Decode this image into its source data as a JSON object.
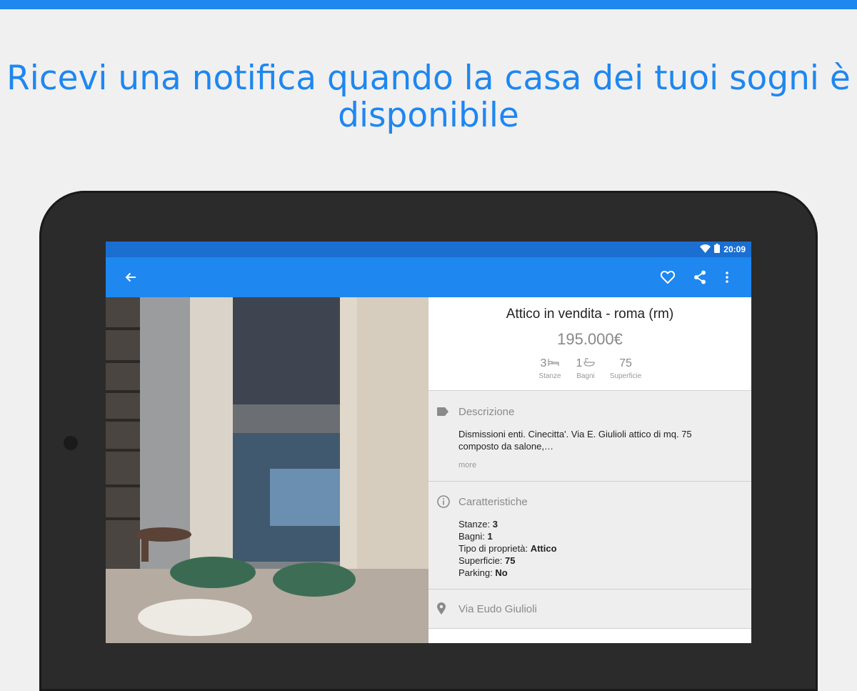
{
  "headline": "Ricevi una notifica quando la casa dei tuoi sogni è disponibile",
  "statusbar": {
    "time": "20:09"
  },
  "listing": {
    "title": "Attico in vendita - roma (rm)",
    "price": "195.000€",
    "stats": [
      {
        "value": "3",
        "label": "Stanze",
        "icon": "bed-icon"
      },
      {
        "value": "1",
        "label": "Bagni",
        "icon": "bathtub-icon"
      },
      {
        "value": "75",
        "label": "Superficie",
        "icon": ""
      }
    ]
  },
  "description": {
    "title": "Descrizione",
    "text": "Dismissioni enti. Cinecitta'. Via E. Giulioli attico di mq. 75 composto da salone,…",
    "more": "more"
  },
  "features": {
    "title": "Caratteristiche",
    "items": [
      {
        "label": "Stanze: ",
        "value": "3"
      },
      {
        "label": "Bagni: ",
        "value": "1"
      },
      {
        "label": "Tipo di proprietà: ",
        "value": "Attico"
      },
      {
        "label": "Superficie: ",
        "value": "75"
      },
      {
        "label": "Parking: ",
        "value": "No"
      }
    ]
  },
  "location": {
    "address": "Via Eudo Giulioli"
  },
  "colors": {
    "brand": "#1e87f0",
    "statusbar": "#1a6fd1"
  }
}
